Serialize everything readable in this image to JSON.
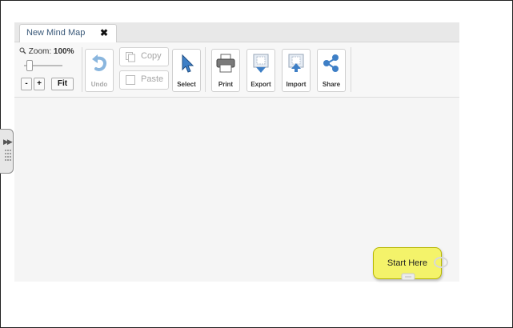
{
  "tabs": [
    {
      "label": "New Mind Map",
      "close": "✖"
    }
  ],
  "zoom": {
    "label": "Zoom:",
    "value": "100%",
    "level_percent": 100,
    "minus": "-",
    "plus": "+",
    "fit": "Fit"
  },
  "toolbar": {
    "undo": "Undo",
    "copy": "Copy",
    "paste": "Paste",
    "select": "Select",
    "print": "Print",
    "export": "Export",
    "import": "Import",
    "share": "Share"
  },
  "node": {
    "label": "Start Here"
  },
  "colors": {
    "node_fill": "#f4f36a",
    "node_border": "#b7b700",
    "accent_blue": "#3e7fc6"
  },
  "icons": [
    "magnifier-icon",
    "undo-icon",
    "copy-icon",
    "paste-icon",
    "cursor-icon",
    "printer-icon",
    "export-icon",
    "import-icon",
    "share-icon",
    "expand-arrows-icon",
    "grip-icon",
    "add-node-icon",
    "drag-handle-icon"
  ]
}
